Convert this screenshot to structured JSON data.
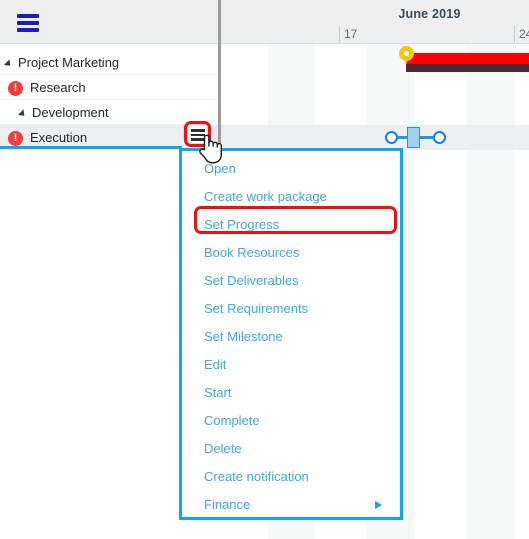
{
  "app": {
    "main_menu_icon": "hamburger-icon"
  },
  "timeline_header": {
    "month": "June 2019",
    "week_ticks": [
      "17",
      "24"
    ]
  },
  "grid": {
    "rows": [
      {
        "label": "Project Marketing",
        "indent": 14,
        "expander": true,
        "warning": false
      },
      {
        "label": "Research",
        "indent": 30,
        "expander": false,
        "warning": true
      },
      {
        "label": "Development",
        "indent": 28,
        "expander": true,
        "warning": false
      },
      {
        "label": "Execution",
        "indent": 30,
        "expander": false,
        "warning": true,
        "selected": true
      }
    ],
    "warning_glyph": "!",
    "row_menu_icon": "row-hamburger-icon"
  },
  "gantt": {
    "summary_bar_color": "#fa0000",
    "summary_shadow_color": "#4a2b31",
    "milestone_icon": "milestone-pin-icon",
    "milestone_color": "#f6c800",
    "selection_color": "#1a9cdc",
    "link_color": "#12a5e8"
  },
  "context_menu": {
    "accent": "#12a5e8",
    "highlight_color": "#ef1010",
    "highlighted_item": "Set Progress",
    "items": [
      {
        "label": "Open",
        "submenu": false
      },
      {
        "label": "Create work package",
        "submenu": false
      },
      {
        "label": "Set Progress",
        "submenu": false
      },
      {
        "label": "Book Resources",
        "submenu": false
      },
      {
        "label": "Set Deliverables",
        "submenu": false
      },
      {
        "label": "Set Requirements",
        "submenu": false
      },
      {
        "label": "Set Milestone",
        "submenu": false
      },
      {
        "label": "Edit",
        "submenu": false
      },
      {
        "label": "Start",
        "submenu": false
      },
      {
        "label": "Complete",
        "submenu": false
      },
      {
        "label": "Delete",
        "submenu": false
      },
      {
        "label": "Create notification",
        "submenu": false
      },
      {
        "label": "Finance",
        "submenu": true
      }
    ]
  },
  "cursor": {
    "type": "pointing-hand-cursor"
  }
}
